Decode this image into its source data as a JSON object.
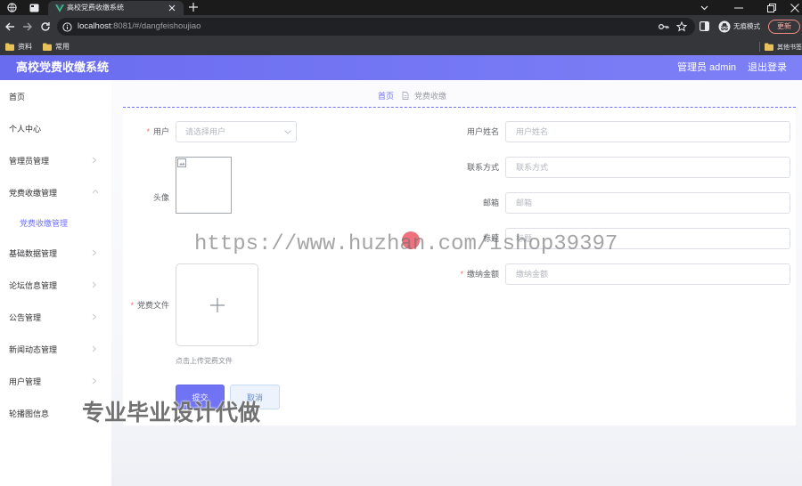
{
  "browser": {
    "tab_title": "高校党费收缴系统",
    "url_host": "localhost",
    "url_path": ":8081/#/dangfeishoujiao",
    "incognito_label": "无痕模式",
    "update_label": "更新",
    "bookmarks": [
      "资料",
      "常用"
    ],
    "other_bookmarks": "其他书签"
  },
  "header": {
    "title": "高校党费收缴系统",
    "user": "管理员 admin",
    "logout": "退出登录"
  },
  "sidebar": {
    "items": [
      "首页",
      "个人中心",
      "管理员管理",
      "党费收缴管理",
      "党费收缴管理",
      "基础数据管理",
      "论坛信息管理",
      "公告管理",
      "新闻动态管理",
      "用户管理",
      "轮播图信息"
    ]
  },
  "breadcrumb": {
    "home": "首页",
    "current": "党费收缴"
  },
  "form": {
    "user": {
      "required": "*",
      "label": "用户",
      "placeholder": "请选择用户"
    },
    "avatar": {
      "label": "头像"
    },
    "file": {
      "required": "*",
      "label": "党费文件",
      "hint": "点击上传党费文件"
    },
    "fields": [
      {
        "label": "用户姓名",
        "placeholder": "用户姓名"
      },
      {
        "label": "联系方式",
        "placeholder": "联系方式"
      },
      {
        "label": "邮箱",
        "placeholder": "邮箱"
      },
      {
        "label": "标题",
        "placeholder": "标题"
      },
      {
        "required": "*",
        "label": "缴纳金额",
        "placeholder": "缴纳金额"
      }
    ],
    "submit": "提交",
    "cancel": "取消"
  },
  "watermarks": {
    "url": "https://www.huzhan.com/ishop39397",
    "slogan": "专业毕业设计代做"
  },
  "colors": {
    "accent": "#7073f4",
    "header_start": "#6a6cf0",
    "header_end": "#7d80f6",
    "required": "#f56c6c"
  }
}
